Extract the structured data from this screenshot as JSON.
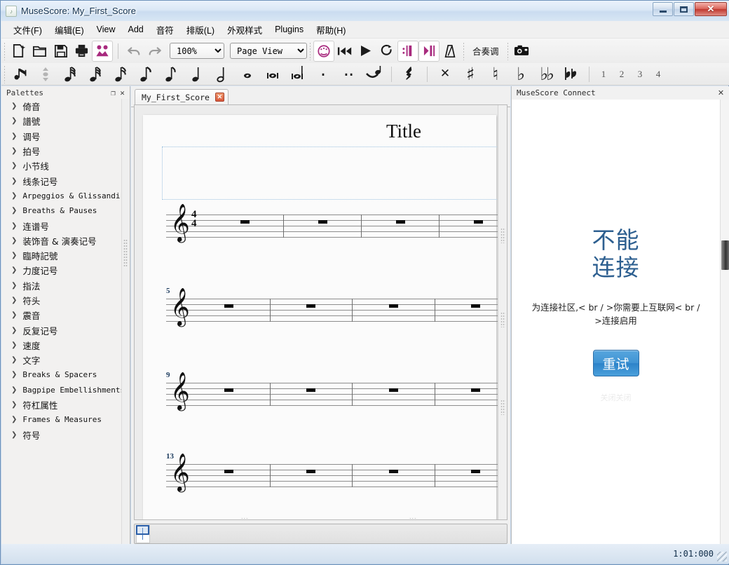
{
  "window": {
    "title": "MuseScore: My_First_Score",
    "app_icon": "musescore-icon",
    "minimize_label": "",
    "maximize_label": "",
    "close_label": "✕"
  },
  "menubar": {
    "items": [
      {
        "label": "文件(F)",
        "name": "menu-file"
      },
      {
        "label": "编辑(E)",
        "name": "menu-edit"
      },
      {
        "label": "View",
        "name": "menu-view"
      },
      {
        "label": "Add",
        "name": "menu-add"
      },
      {
        "label": "音符",
        "name": "menu-note"
      },
      {
        "label": "排版(L)",
        "name": "menu-layout"
      },
      {
        "label": "外观样式",
        "name": "menu-style"
      },
      {
        "label": "Plugins",
        "name": "menu-plugins"
      },
      {
        "label": "帮助(H)",
        "name": "menu-help"
      }
    ]
  },
  "toolbar_main": {
    "new_icon": "new-score-icon",
    "open_icon": "open-file-icon",
    "save_icon": "save-icon",
    "print_icon": "print-icon",
    "connect_icon": "musescore-connect-icon",
    "undo_icon": "undo-icon",
    "redo_icon": "redo-icon",
    "zoom_value": "100%",
    "zoom_options": [
      "100%"
    ],
    "view_value": "Page View",
    "view_options": [
      "Page View"
    ],
    "note_input_icon": "note-input-icon",
    "rewind_icon": "rewind-icon",
    "play_icon": "play-icon",
    "loop_icon": "loop-playback-icon",
    "play_repeats_icon": "play-repeats-icon",
    "pan_score_icon": "pan-score-icon",
    "metronome_icon": "metronome-icon",
    "concert_pitch_label": "合奏调",
    "screenshot_icon": "camera-capture-icon"
  },
  "toolbar_notes": {
    "note_entry_icon": "note-entry-icon",
    "pitch_updown_icon": "pitch-up-down-icon",
    "durations": [
      {
        "name": "duration-64th",
        "glyph": "♫"
      },
      {
        "name": "duration-32nd",
        "glyph": "♫"
      },
      {
        "name": "duration-16th",
        "glyph": "♫"
      },
      {
        "name": "duration-eighth",
        "glyph": "♪"
      },
      {
        "name": "duration-eighth-2",
        "glyph": "♪"
      },
      {
        "name": "duration-quarter",
        "glyph": "♩"
      },
      {
        "name": "duration-half",
        "glyph": "ᴕE"
      },
      {
        "name": "duration-whole",
        "glyph": "○"
      },
      {
        "name": "duration-breve",
        "glyph": "ᴕC"
      },
      {
        "name": "duration-longa",
        "glyph": "ᴕB"
      }
    ],
    "dot_label": ".",
    "double_dot_label": "..",
    "tie_icon": "tie-icon",
    "rest_icon": "rest-icon",
    "accidentals": [
      {
        "name": "accidental-double-sharp",
        "glyph": "×"
      },
      {
        "name": "accidental-sharp",
        "glyph": "♯"
      },
      {
        "name": "accidental-natural",
        "glyph": "♮"
      },
      {
        "name": "accidental-flat",
        "glyph": "♭"
      },
      {
        "name": "accidental-double-flat",
        "glyph": "♭♭"
      },
      {
        "name": "accidental-flat-sharp-group",
        "glyph": "♭♯"
      }
    ],
    "voices": [
      "1",
      "2",
      "3",
      "4"
    ]
  },
  "palettes": {
    "title": "Palettes",
    "float_icon": "undock-icon",
    "close_icon": "close-icon",
    "items": [
      {
        "label": "倚音",
        "script": "cjk"
      },
      {
        "label": "譜號",
        "script": "cjk"
      },
      {
        "label": "调号",
        "script": "cjk"
      },
      {
        "label": "拍号",
        "script": "cjk"
      },
      {
        "label": "小节线",
        "script": "cjk"
      },
      {
        "label": "线条记号",
        "script": "cjk"
      },
      {
        "label": "Arpeggios & Glissandi",
        "script": "latin"
      },
      {
        "label": "Breaths & Pauses",
        "script": "latin"
      },
      {
        "label": "连谱号",
        "script": "cjk"
      },
      {
        "label": "装饰音 & 演奏记号",
        "script": "cjk"
      },
      {
        "label": "臨時記號",
        "script": "cjk"
      },
      {
        "label": "力度记号",
        "script": "cjk"
      },
      {
        "label": "指法",
        "script": "cjk"
      },
      {
        "label": "符头",
        "script": "cjk"
      },
      {
        "label": "震音",
        "script": "cjk"
      },
      {
        "label": "反复记号",
        "script": "cjk"
      },
      {
        "label": "速度",
        "script": "cjk"
      },
      {
        "label": "文字",
        "script": "cjk"
      },
      {
        "label": "Breaks & Spacers",
        "script": "latin"
      },
      {
        "label": "Bagpipe Embellishments",
        "script": "latin"
      },
      {
        "label": "符杠属性",
        "script": "cjk"
      },
      {
        "label": "Frames & Measures",
        "script": "latin"
      },
      {
        "label": "符号",
        "script": "cjk"
      }
    ],
    "expand_arrow": "chevron-right-icon"
  },
  "score": {
    "tab_label": "My_First_Score",
    "tab_close_label": "✕",
    "page_title": "Title",
    "clef": "treble-clef",
    "clef_glyph": "𝄞",
    "time_signature": {
      "numerator": "4",
      "denominator": "4"
    },
    "systems": [
      {
        "measure_number": "",
        "measures": 4
      },
      {
        "measure_number": "5",
        "measures": 4
      },
      {
        "measure_number": "9",
        "measures": 4
      },
      {
        "measure_number": "13",
        "measures": 4
      }
    ],
    "page_break_dots": "..."
  },
  "connect": {
    "title": "MuseScore Connect",
    "close_label": "✕",
    "headline": "不能\n连接",
    "headline_line1": "不能",
    "headline_line2": "连接",
    "message": "为连接社区,< br / >你需要上互联网< br / >连接启用",
    "retry_label": "重试",
    "dismiss_label": "关闭关闭"
  },
  "statusbar": {
    "position": "1:01:000"
  },
  "colors": {
    "accent_magenta": "#a82a7e",
    "connect_blue": "#2d5f90",
    "retry_button": "#3f93d3",
    "title_text": "#12314f",
    "measure_number": "#1c3b5e"
  }
}
